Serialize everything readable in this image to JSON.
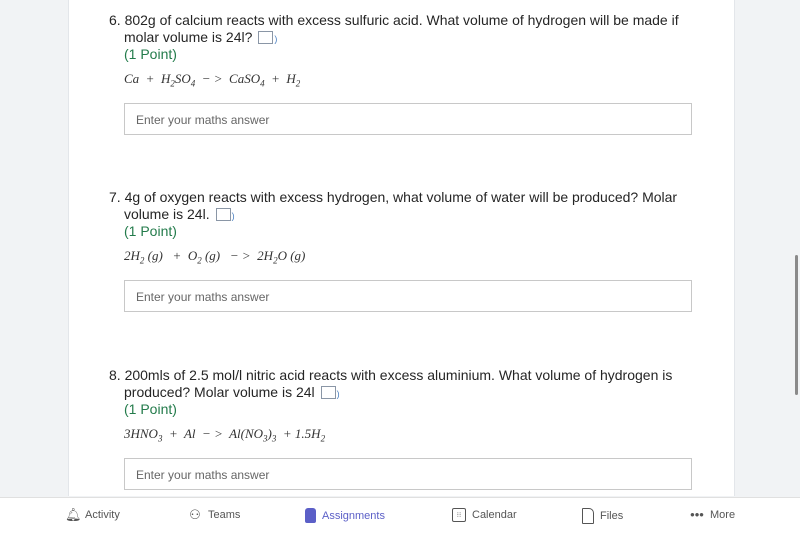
{
  "questions": [
    {
      "number": "6.",
      "text": "802g of calcium reacts with excess sulfuric acid. What volume of hydrogen will be made if molar volume is 24l?",
      "points": "(1 Point)",
      "equation": [
        [
          "Ca  +  H",
          ""
        ],
        [
          "2",
          "s"
        ],
        [
          "SO",
          ""
        ],
        [
          "4",
          "s"
        ],
        [
          "  − >  CaSO",
          ""
        ],
        [
          "4",
          "s"
        ],
        [
          "  +  H",
          ""
        ],
        [
          "2",
          "s"
        ]
      ],
      "placeholder": "Enter your maths answer"
    },
    {
      "number": "7.",
      "text": "4g of oxygen reacts with excess hydrogen, what volume of water will be produced? Molar volume is 24l.",
      "points": "(1 Point)",
      "equation": [
        [
          "2H",
          ""
        ],
        [
          "2",
          "s"
        ],
        [
          " (g)   +  O",
          ""
        ],
        [
          "2",
          "s"
        ],
        [
          " (g)   − >  2H",
          ""
        ],
        [
          "2",
          "s"
        ],
        [
          "O (g)",
          ""
        ]
      ],
      "placeholder": "Enter your maths answer"
    },
    {
      "number": "8.",
      "text": "200mls of 2.5 mol/l nitric acid reacts with excess aluminium. What volume of hydrogen is produced? Molar volume is 24l",
      "points": "(1 Point)",
      "equation": [
        [
          "3HNO",
          ""
        ],
        [
          "3",
          "s"
        ],
        [
          "  +  Al  − >  Al(NO",
          ""
        ],
        [
          "3",
          "s"
        ],
        [
          ")",
          ""
        ],
        [
          "3",
          "s"
        ],
        [
          "  + 1.5H",
          ""
        ],
        [
          "2",
          "s"
        ]
      ],
      "placeholder": "Enter your maths answer"
    }
  ],
  "nav": [
    {
      "label": "Activity",
      "icon": "bell-icon"
    },
    {
      "label": "Teams",
      "icon": "teams-icon"
    },
    {
      "label": "Assignments",
      "icon": "backpack-icon",
      "active": true
    },
    {
      "label": "Calendar",
      "icon": "calendar-icon"
    },
    {
      "label": "Files",
      "icon": "file-icon"
    },
    {
      "label": "More",
      "icon": "more-icon"
    }
  ],
  "colors": {
    "accent": "#5b5fc7",
    "points": "#237b4b"
  }
}
